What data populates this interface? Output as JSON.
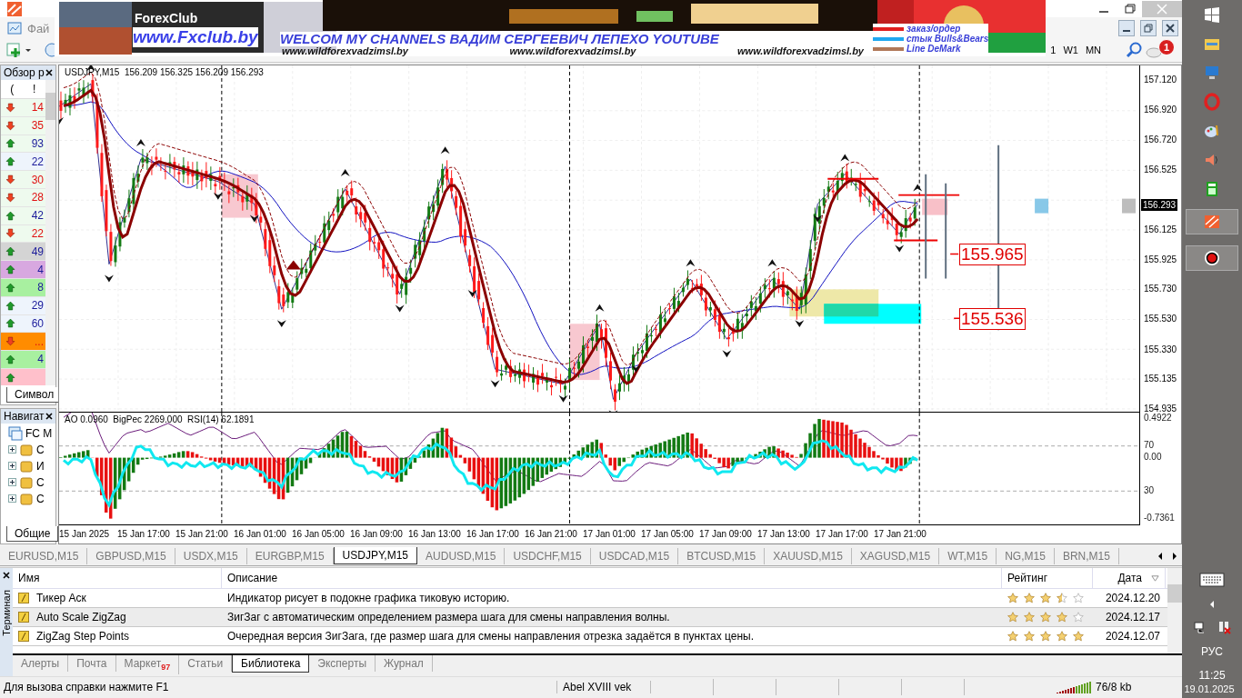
{
  "menu": {
    "items": [
      "Фай"
    ]
  },
  "toolbar": {
    "timeframes": [
      {
        "label": "1",
        "selected": false
      },
      {
        "label": "W1",
        "selected": false
      },
      {
        "label": "MN",
        "selected": false
      }
    ],
    "notifications": "1"
  },
  "banner": {
    "brand": "ForexClub",
    "site": "www.Fxclub.by",
    "headline": "WELCOM MY CHANNELS ВАДИМ СЕРГЕЕВИЧ ЛЕПЕХО YOUTUBE",
    "links": [
      "www.wildforexvadzimsl.by",
      "www.wildforexvadzimsl.by",
      "www.wildforexvadzimsl.by"
    ],
    "legend": [
      {
        "label": "заказ/ордер",
        "color": "#e02020"
      },
      {
        "label": "стык Bulls&Bears",
        "color": "#20a8f0"
      },
      {
        "label": "Line DeMark",
        "color": "#b07858"
      }
    ]
  },
  "market_watch": {
    "title": "Обзор р",
    "columns": [
      "(",
      "!"
    ],
    "tab": "Символ",
    "rows": [
      {
        "up": false,
        "value": "14",
        "color": "#eefaee"
      },
      {
        "up": false,
        "value": "35",
        "color": "#eefaee"
      },
      {
        "up": true,
        "value": "93",
        "color": "#eefaee"
      },
      {
        "up": true,
        "value": "22",
        "color": "#eef4fc"
      },
      {
        "up": false,
        "value": "30",
        "color": "#eefaee"
      },
      {
        "up": false,
        "value": "28",
        "color": "#eefaee"
      },
      {
        "up": true,
        "value": "42",
        "color": "#eefaee"
      },
      {
        "up": false,
        "value": "22",
        "color": "#eefaee"
      },
      {
        "up": true,
        "value": "49",
        "color": "#d4d4d4"
      },
      {
        "up": true,
        "value": "4",
        "color": "#d8a8e0"
      },
      {
        "up": true,
        "value": "8",
        "color": "#a8f0a0"
      },
      {
        "up": true,
        "value": "29",
        "color": "#eef4fc"
      },
      {
        "up": true,
        "value": "60",
        "color": "#eef4fc"
      },
      {
        "up": false,
        "value": "...",
        "color": "#ff8c00"
      },
      {
        "up": true,
        "value": "4",
        "color": "#a8f0a0"
      },
      {
        "up": true,
        "color": "#ffc0cb"
      }
    ]
  },
  "navigator": {
    "title": "Навигат",
    "tab": "Общие",
    "items": [
      {
        "label": "FC M",
        "children": [
          {
            "label": "С",
            "expanded": false
          },
          {
            "label": "И",
            "expanded": false
          },
          {
            "label": "С",
            "expanded": false
          },
          {
            "label": "С",
            "expanded": false
          }
        ]
      }
    ]
  },
  "chart": {
    "header": "USDJPY,M15  156.209 156.325 156.209 156.293",
    "current_price": "156.293",
    "price_ticks": [
      "157.120",
      "156.920",
      "156.720",
      "156.525",
      "156.125",
      "155.925",
      "155.730",
      "155.530",
      "155.330",
      "155.135",
      "154.935"
    ],
    "levels": [
      "155.965",
      "155.536"
    ],
    "indicator_header": "AO 0.0960  BigPec 2269.000  RSI(14) 62.1891",
    "indicator_ticks": [
      "0.4922",
      "70",
      "0.00",
      "30",
      "-0.7361"
    ],
    "time_labels": [
      "15 Jan 2025",
      "15 Jan 17:00",
      "15 Jan 21:00",
      "16 Jan 01:00",
      "16 Jan 05:00",
      "16 Jan 09:00",
      "16 Jan 13:00",
      "16 Jan 17:00",
      "16 Jan 21:00",
      "17 Jan 01:00",
      "17 Jan 05:00",
      "17 Jan 09:00",
      "17 Jan 13:00",
      "17 Jan 17:00",
      "17 Jan 21:00"
    ]
  },
  "chart_tabs": [
    {
      "label": "EURUSD,M15",
      "selected": false
    },
    {
      "label": "GBPUSD,M15",
      "selected": false
    },
    {
      "label": "USDX,M15",
      "selected": false
    },
    {
      "label": "EURGBP,M15",
      "selected": false
    },
    {
      "label": "USDJPY,M15",
      "selected": true
    },
    {
      "label": "AUDUSD,M15",
      "selected": false
    },
    {
      "label": "USDCHF,M15",
      "selected": false
    },
    {
      "label": "USDCAD,M15",
      "selected": false
    },
    {
      "label": "BTCUSD,M15",
      "selected": false
    },
    {
      "label": "XAUUSD,M15",
      "selected": false
    },
    {
      "label": "XAGUSD,M15",
      "selected": false
    },
    {
      "label": "WT,M15",
      "selected": false
    },
    {
      "label": "NG,M15",
      "selected": false
    },
    {
      "label": "BRN,M15",
      "selected": false
    }
  ],
  "terminal": {
    "side_label": "Терминал",
    "columns": [
      "Имя",
      "Описание",
      "Рейтинг",
      "Дата"
    ],
    "rows": [
      {
        "name": "Тикер Аск",
        "description": "Индикатор рисует в подокне графика тиковую историю.",
        "stars": 3.5,
        "date": "2024.12.20",
        "selected": false
      },
      {
        "name": "Auto Scale ZigZag",
        "description": "ЗигЗаг с автоматическим определением размера шага для смены направления волны.",
        "stars": 4,
        "date": "2024.12.17",
        "selected": true
      },
      {
        "name": "ZigZag Step Points",
        "description": "Очередная версия ЗигЗага, где размер шага для смены направления отрезка задаётся в пунктах цены.",
        "stars": 5,
        "date": "2024.12.07",
        "selected": false
      }
    ],
    "tabs": [
      {
        "label": "Алерты",
        "selected": false
      },
      {
        "label": "Почта",
        "selected": false
      },
      {
        "label": "Маркет",
        "badge": "97",
        "selected": false
      },
      {
        "label": "Статьи",
        "selected": false
      },
      {
        "label": "Библиотека",
        "selected": true
      },
      {
        "label": "Эксперты",
        "selected": false
      },
      {
        "label": "Журнал",
        "selected": false
      }
    ]
  },
  "status_bar": {
    "help": "Для вызова справки нажмите F1",
    "profile": "Abel XVIII vek",
    "traffic": "76/8 kb"
  },
  "taskbar": {
    "language": "РУС",
    "time": "11:25",
    "date": "19.01.2025"
  }
}
